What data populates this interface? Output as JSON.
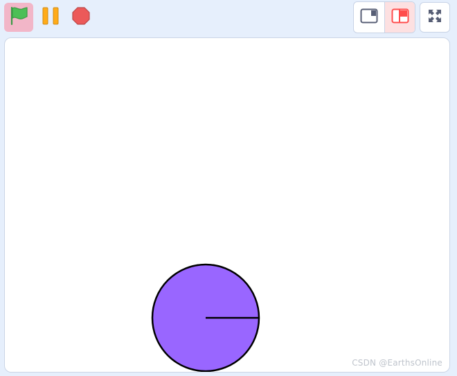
{
  "toolbar": {
    "left_buttons": [
      {
        "name": "green-flag",
        "icon": "green-flag-icon"
      },
      {
        "name": "pause",
        "icon": "pause-icon"
      },
      {
        "name": "stop",
        "icon": "stop-icon"
      }
    ],
    "right_buttons": [
      {
        "name": "small-stage",
        "icon": "small-stage-icon",
        "active": false
      },
      {
        "name": "large-stage",
        "icon": "large-stage-icon",
        "active": true
      },
      {
        "name": "fullscreen",
        "icon": "fullscreen-icon"
      }
    ],
    "colors": {
      "background": "#e6effc",
      "flag_active_bg": "#f2b6c8",
      "flag_green": "#4cbf56",
      "pause_orange": "#ffab19",
      "stop_red": "#ec5959",
      "active_toggle_bg": "#fde0e1",
      "active_toggle_icon": "#ff4c4c"
    }
  },
  "stage": {
    "background": "#ffffff",
    "sprite": {
      "shape": "circle-with-radius-line",
      "fill": "#9966ff",
      "stroke": "#000000"
    }
  },
  "watermark": {
    "text": "CSDN @EarthsOnline"
  }
}
